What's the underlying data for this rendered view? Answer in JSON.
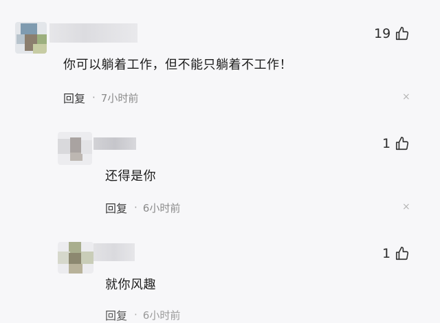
{
  "comments": [
    {
      "text": "你可以躺着工作，但不能只躺着不工作！",
      "likes": "19",
      "reply_label": "回复",
      "separator": "·",
      "time": "7小时前",
      "close_icon": "×"
    },
    {
      "text": "还得是你",
      "likes": "1",
      "reply_label": "回复",
      "separator": "·",
      "time": "6小时前",
      "close_icon": "×"
    },
    {
      "text": "就你风趣",
      "likes": "1",
      "reply_label": "回复",
      "separator": "·",
      "time": "6小时前",
      "close_icon": "×"
    }
  ],
  "icons": {
    "like": "thumbs-up-icon",
    "close": "close-icon"
  },
  "colors": {
    "background": "#f7f7f9",
    "text": "#1c1c1c",
    "meta": "#8a8a8a",
    "close": "#b5b5b5"
  }
}
